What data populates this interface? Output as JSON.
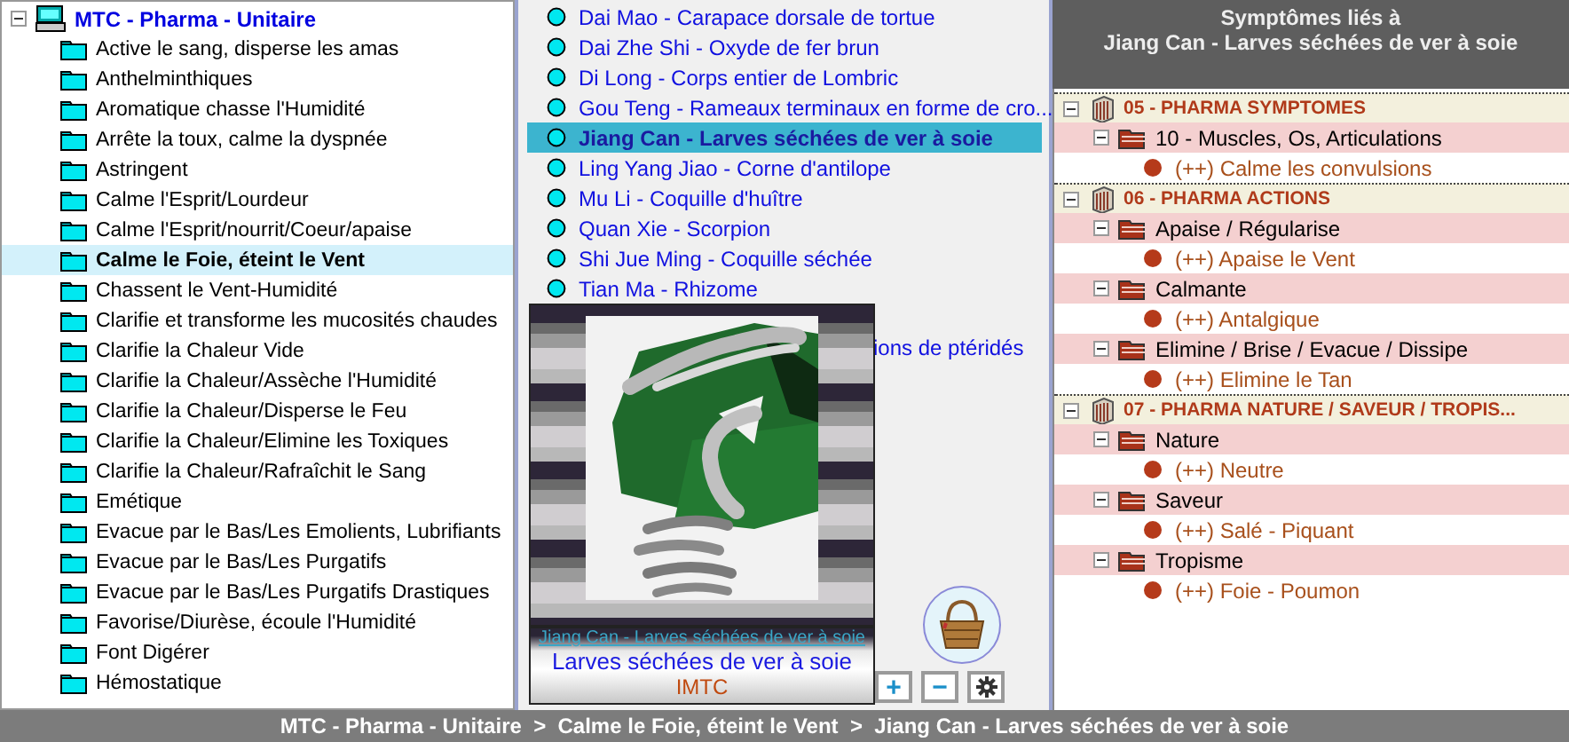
{
  "navigation_tree": {
    "root": {
      "label": "MTC - Pharma - Unitaire",
      "expanded": true,
      "children": [
        {
          "label": "Active le sang, disperse les amas",
          "selected": false
        },
        {
          "label": "Anthelminthiques",
          "selected": false
        },
        {
          "label": "Aromatique chasse l'Humidité",
          "selected": false
        },
        {
          "label": "Arrête la toux, calme la dyspnée",
          "selected": false
        },
        {
          "label": "Astringent",
          "selected": false
        },
        {
          "label": "Calme l'Esprit/Lourdeur",
          "selected": false
        },
        {
          "label": "Calme l'Esprit/nourrit/Coeur/apaise",
          "selected": false
        },
        {
          "label": "Calme le Foie, éteint le Vent",
          "selected": true
        },
        {
          "label": "Chassent le Vent-Humidité",
          "selected": false
        },
        {
          "label": "Clarifie et transforme les mucosités chaudes",
          "selected": false
        },
        {
          "label": "Clarifie la Chaleur Vide",
          "selected": false
        },
        {
          "label": "Clarifie la Chaleur/Assèche l'Humidité",
          "selected": false
        },
        {
          "label": "Clarifie la Chaleur/Disperse le Feu",
          "selected": false
        },
        {
          "label": "Clarifie la Chaleur/Elimine les Toxiques",
          "selected": false
        },
        {
          "label": "Clarifie la Chaleur/Rafraîchit le Sang",
          "selected": false
        },
        {
          "label": "Emétique",
          "selected": false
        },
        {
          "label": "Evacue par le Bas/Les Emolients, Lubrifiants",
          "selected": false
        },
        {
          "label": "Evacue par le Bas/Les Purgatifs",
          "selected": false
        },
        {
          "label": "Evacue par le Bas/Les Purgatifs Drastiques",
          "selected": false
        },
        {
          "label": "Favorise/Diurèse, écoule l'Humidité",
          "selected": false
        },
        {
          "label": "Font Digérer",
          "selected": false
        },
        {
          "label": "Hémostatique",
          "selected": false
        }
      ]
    }
  },
  "remedy_list": {
    "items": [
      {
        "label": "Dai Mao - Carapace dorsale de tortue",
        "selected": false
      },
      {
        "label": "Dai Zhe Shi - Oxyde de fer brun",
        "selected": false
      },
      {
        "label": "Di Long - Corps entier de Lombric",
        "selected": false
      },
      {
        "label": "Gou Teng - Rameaux terminaux en forme de cro...",
        "selected": false
      },
      {
        "label": "Jiang Can - Larves séchées de ver à soie",
        "selected": true
      },
      {
        "label": "Ling Yang Jiao - Corne d'antilope",
        "selected": false
      },
      {
        "label": "Mu Li - Coquille d'huître",
        "selected": false
      },
      {
        "label": "Quan Xie - Scorpion",
        "selected": false
      },
      {
        "label": "Shi Jue Ming - Coquille séchée",
        "selected": false
      },
      {
        "label": "Tian Ma - Rhizome",
        "selected": false
      }
    ],
    "partial_text": "ions de ptéridés"
  },
  "preview": {
    "link": "Jiang Can - Larves séchées de ver à soie",
    "caption": "Larves séchées de ver à soie",
    "source": "IMTC"
  },
  "toolbar": {
    "buttons": [
      {
        "kind": "text",
        "label": "+"
      },
      {
        "kind": "text",
        "label": "−"
      },
      {
        "kind": "settings"
      }
    ]
  },
  "symptoms_panel": {
    "title_lines": [
      "Symptômes liés à",
      "Jiang Can - Larves séchées de ver à soie"
    ],
    "groups": [
      {
        "label": "05 - PHARMA SYMPTOMES",
        "expanded": true,
        "children": [
          {
            "label": "10 - Muscles, Os, Articulations",
            "expanded": true,
            "children": [
              {
                "label": "(++) Calme les convulsions"
              }
            ]
          }
        ]
      },
      {
        "label": "06 - PHARMA ACTIONS",
        "expanded": true,
        "children": [
          {
            "label": "Apaise / Régularise",
            "expanded": true,
            "children": [
              {
                "label": "(++) Apaise le Vent"
              }
            ]
          },
          {
            "label": "Calmante",
            "expanded": true,
            "children": [
              {
                "label": "(++) Antalgique"
              }
            ]
          },
          {
            "label": "Elimine / Brise / Evacue / Dissipe",
            "expanded": true,
            "children": [
              {
                "label": "(++) Elimine le Tan"
              }
            ]
          }
        ]
      },
      {
        "label": "07 - PHARMA NATURE / SAVEUR / TROPIS...",
        "expanded": true,
        "children": [
          {
            "label": "Nature",
            "expanded": true,
            "children": [
              {
                "label": "(++) Neutre"
              }
            ]
          },
          {
            "label": "Saveur",
            "expanded": true,
            "children": [
              {
                "label": "(++) Salé - Piquant"
              }
            ]
          },
          {
            "label": "Tropisme",
            "expanded": true,
            "children": [
              {
                "label": "(++) Foie - Poumon"
              }
            ]
          }
        ]
      }
    ]
  },
  "status_bar": "MTC - Pharma - Unitaire  >  Calme le Foie, éteint le Vent  >  Jiang Can - Larves séchées de ver à soie"
}
